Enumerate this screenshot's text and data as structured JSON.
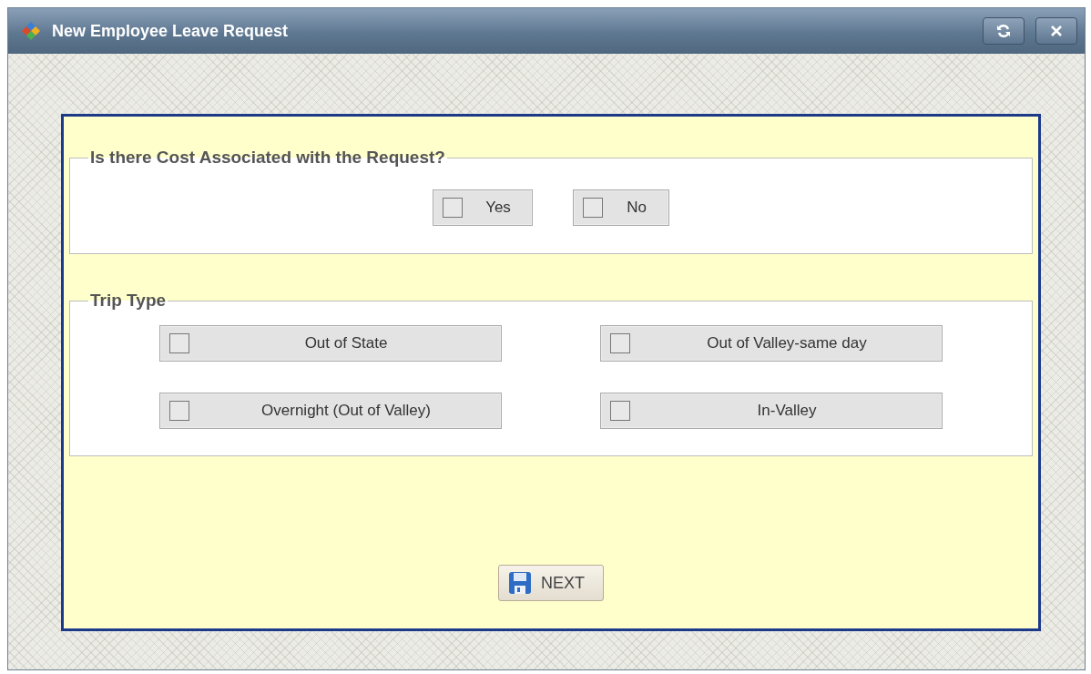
{
  "window": {
    "title": "New Employee Leave Request"
  },
  "cost_section": {
    "title": "Is there Cost Associated with the Request?",
    "options": [
      {
        "label": "Yes",
        "checked": false
      },
      {
        "label": "No",
        "checked": false
      }
    ]
  },
  "trip_section": {
    "title": "Trip Type",
    "options": [
      {
        "label": "Out of State",
        "checked": false
      },
      {
        "label": "Out of Valley-same day",
        "checked": false
      },
      {
        "label": "Overnight (Out of Valley)",
        "checked": false
      },
      {
        "label": "In-Valley",
        "checked": false
      }
    ]
  },
  "next_button": {
    "label": "NEXT"
  }
}
